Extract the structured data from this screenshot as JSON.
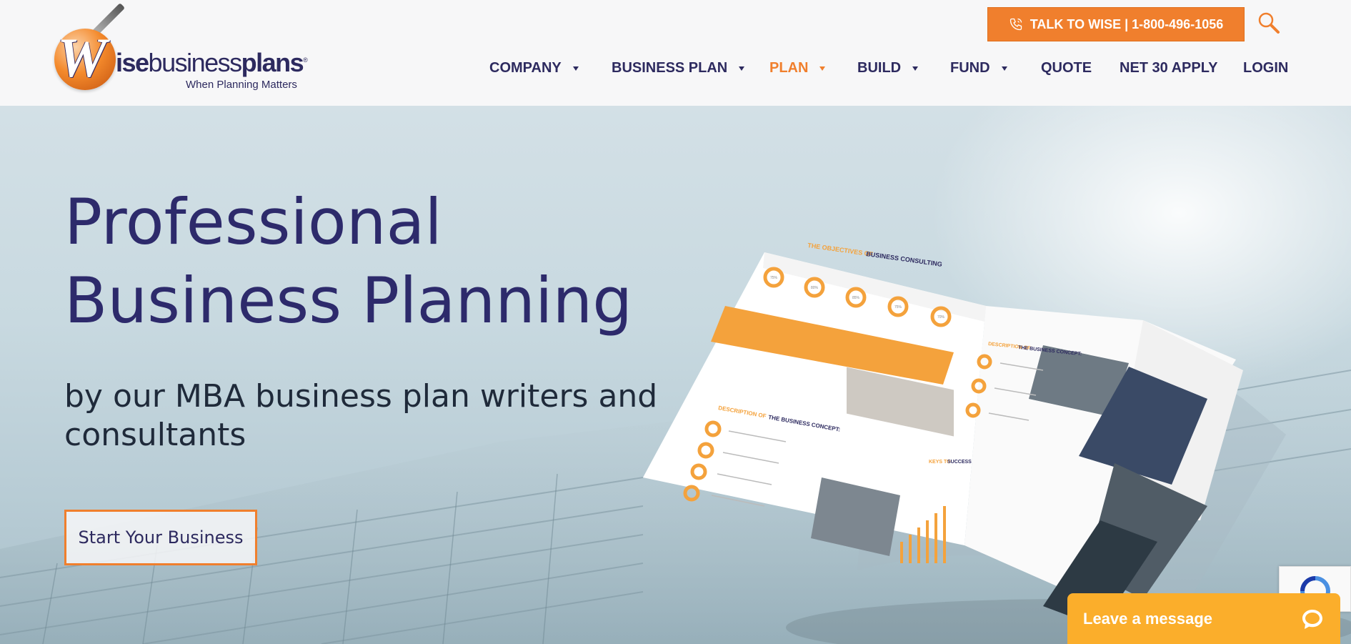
{
  "header": {
    "logo": {
      "letter": "W",
      "word_bold1": "ise",
      "word_light": "business",
      "word_bold2": "plans",
      "reg": "®",
      "tagline": "When Planning Matters"
    },
    "cta_label": "TALK TO WISE | 1-800-496-1056",
    "nav": [
      {
        "label": "COMPANY",
        "dropdown": true,
        "active": false
      },
      {
        "label": "BUSINESS PLAN",
        "dropdown": true,
        "active": false
      },
      {
        "label": "PLAN",
        "dropdown": true,
        "active": true
      },
      {
        "label": "BUILD",
        "dropdown": true,
        "active": false
      },
      {
        "label": "FUND",
        "dropdown": true,
        "active": false
      },
      {
        "label": "QUOTE",
        "dropdown": false,
        "active": false
      },
      {
        "label": "NET 30 APPLY",
        "dropdown": false,
        "active": false
      },
      {
        "label": "LOGIN",
        "dropdown": false,
        "active": false
      }
    ]
  },
  "hero": {
    "title_line1": "Professional",
    "title_line2": "Business Planning",
    "subtitle": "by our MBA business plan writers and consultants",
    "button_label": "Start Your Business"
  },
  "brochure": {
    "heading1_accent": "THE OBJECTIVES OF",
    "heading1": "BUSINESS CONSULTING",
    "heading2_accent": "DESCRIPTION OF",
    "heading2": "THE BUSINESS CONCEPT:",
    "heading3_accent": "DESCRIPTION OF",
    "heading3": "THE BUSINESS CONCEPT:",
    "heading4_accent": "KEYS TO",
    "heading4": "SUCCESS",
    "percent_labels": [
      "75%",
      "80%",
      "85%",
      "75%",
      "70%"
    ]
  },
  "chat": {
    "label": "Leave a message"
  },
  "colors": {
    "brand_navy": "#2d2a5f",
    "accent_orange": "#f07f2d",
    "chat_yellow": "#fbae2b"
  },
  "icons": [
    "phone-icon",
    "search-icon",
    "caret-down-icon",
    "chat-bubble-icon",
    "recaptcha-icon"
  ]
}
